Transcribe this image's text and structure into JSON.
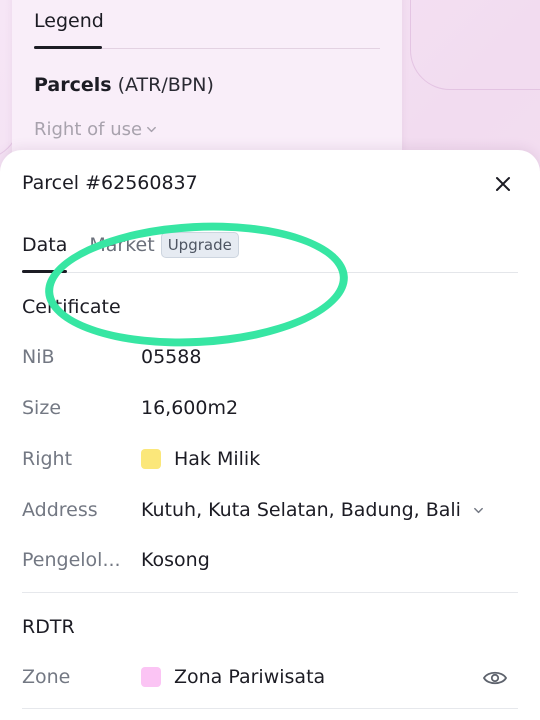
{
  "legend": {
    "title": "Legend",
    "parcels_strong": "Parcels",
    "parcels_suffix": " (ATR/BPN)",
    "right_of_use": "Right of use"
  },
  "sheet": {
    "title": "Parcel #62560837",
    "tabs": {
      "data": "Data",
      "market": "Market",
      "upgrade_badge": "Upgrade"
    },
    "certificate": {
      "section_title": "Certificate",
      "nib_label": "NiB",
      "nib_value": "05588",
      "size_label": "Size",
      "size_value": "16,600m2",
      "right_label": "Right",
      "right_value": "Hak Milik",
      "right_color": "#fbe77a",
      "address_label": "Address",
      "address_value": "Kutuh, Kuta Selatan, Badung, Bali",
      "pengelola_label": "Pengelol...",
      "pengelola_value": "Kosong"
    },
    "rdtr": {
      "section_title": "RDTR",
      "zone_label": "Zone",
      "zone_value": "Zona Pariwisata",
      "zone_color": "#fbc4f4"
    }
  },
  "colors": {
    "annotation": "#37e6a3",
    "background": "#f4e1f2"
  },
  "icons": [
    "chevron-down-icon",
    "close-icon",
    "eye-icon"
  ]
}
